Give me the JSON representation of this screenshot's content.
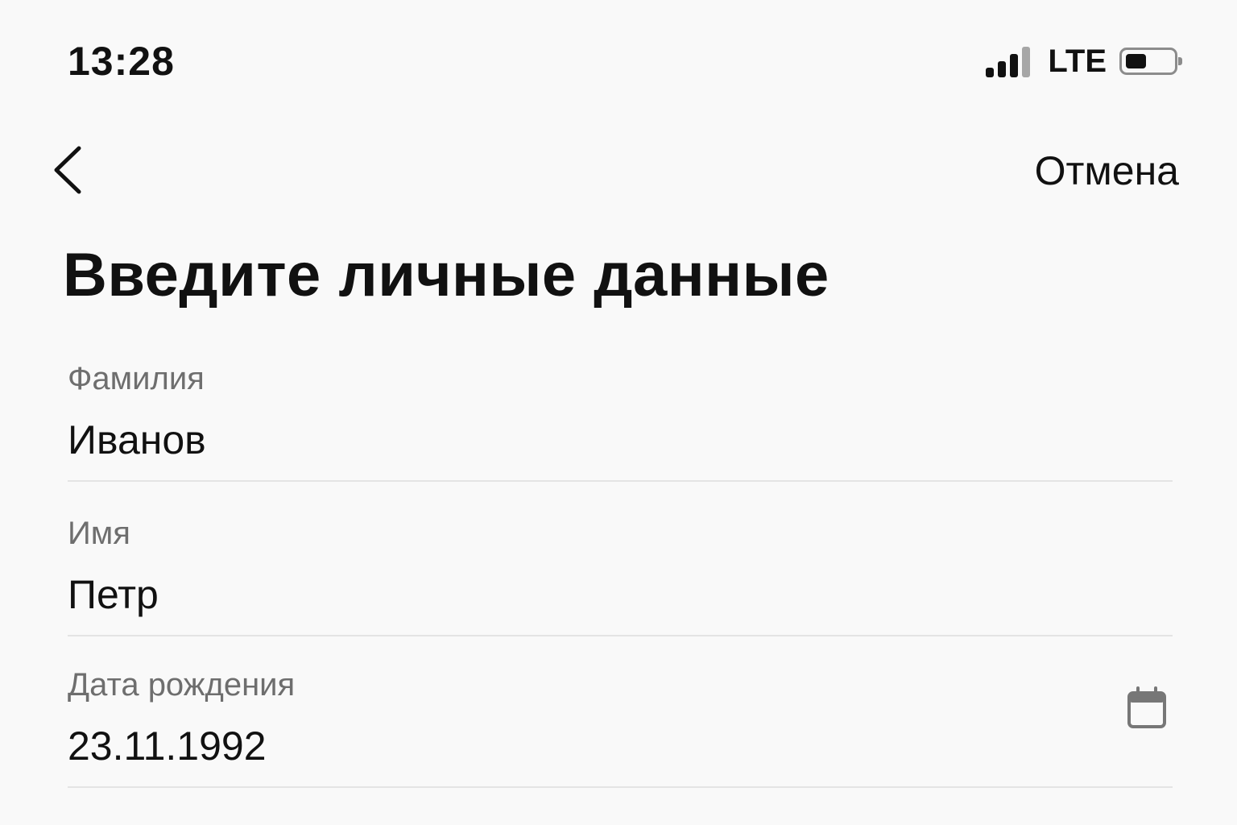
{
  "status_bar": {
    "time": "13:28",
    "network": "LTE",
    "signal_bars_active": 3,
    "signal_bars_total": 4,
    "battery_level": 0.45
  },
  "nav": {
    "back_icon": "chevron-left-icon",
    "cancel_label": "Отмена"
  },
  "page": {
    "title": "Введите личные данные"
  },
  "form": {
    "last_name": {
      "label": "Фамилия",
      "value": "Иванов"
    },
    "first_name": {
      "label": "Имя",
      "value": "Петр"
    },
    "birth_date": {
      "label": "Дата рождения",
      "value": "23.11.1992",
      "icon": "calendar-icon"
    }
  },
  "colors": {
    "background": "#f9f9f9",
    "text": "#111111",
    "label": "#6e6e6e",
    "divider": "#e4e4e4",
    "icon_gray": "#777777"
  }
}
